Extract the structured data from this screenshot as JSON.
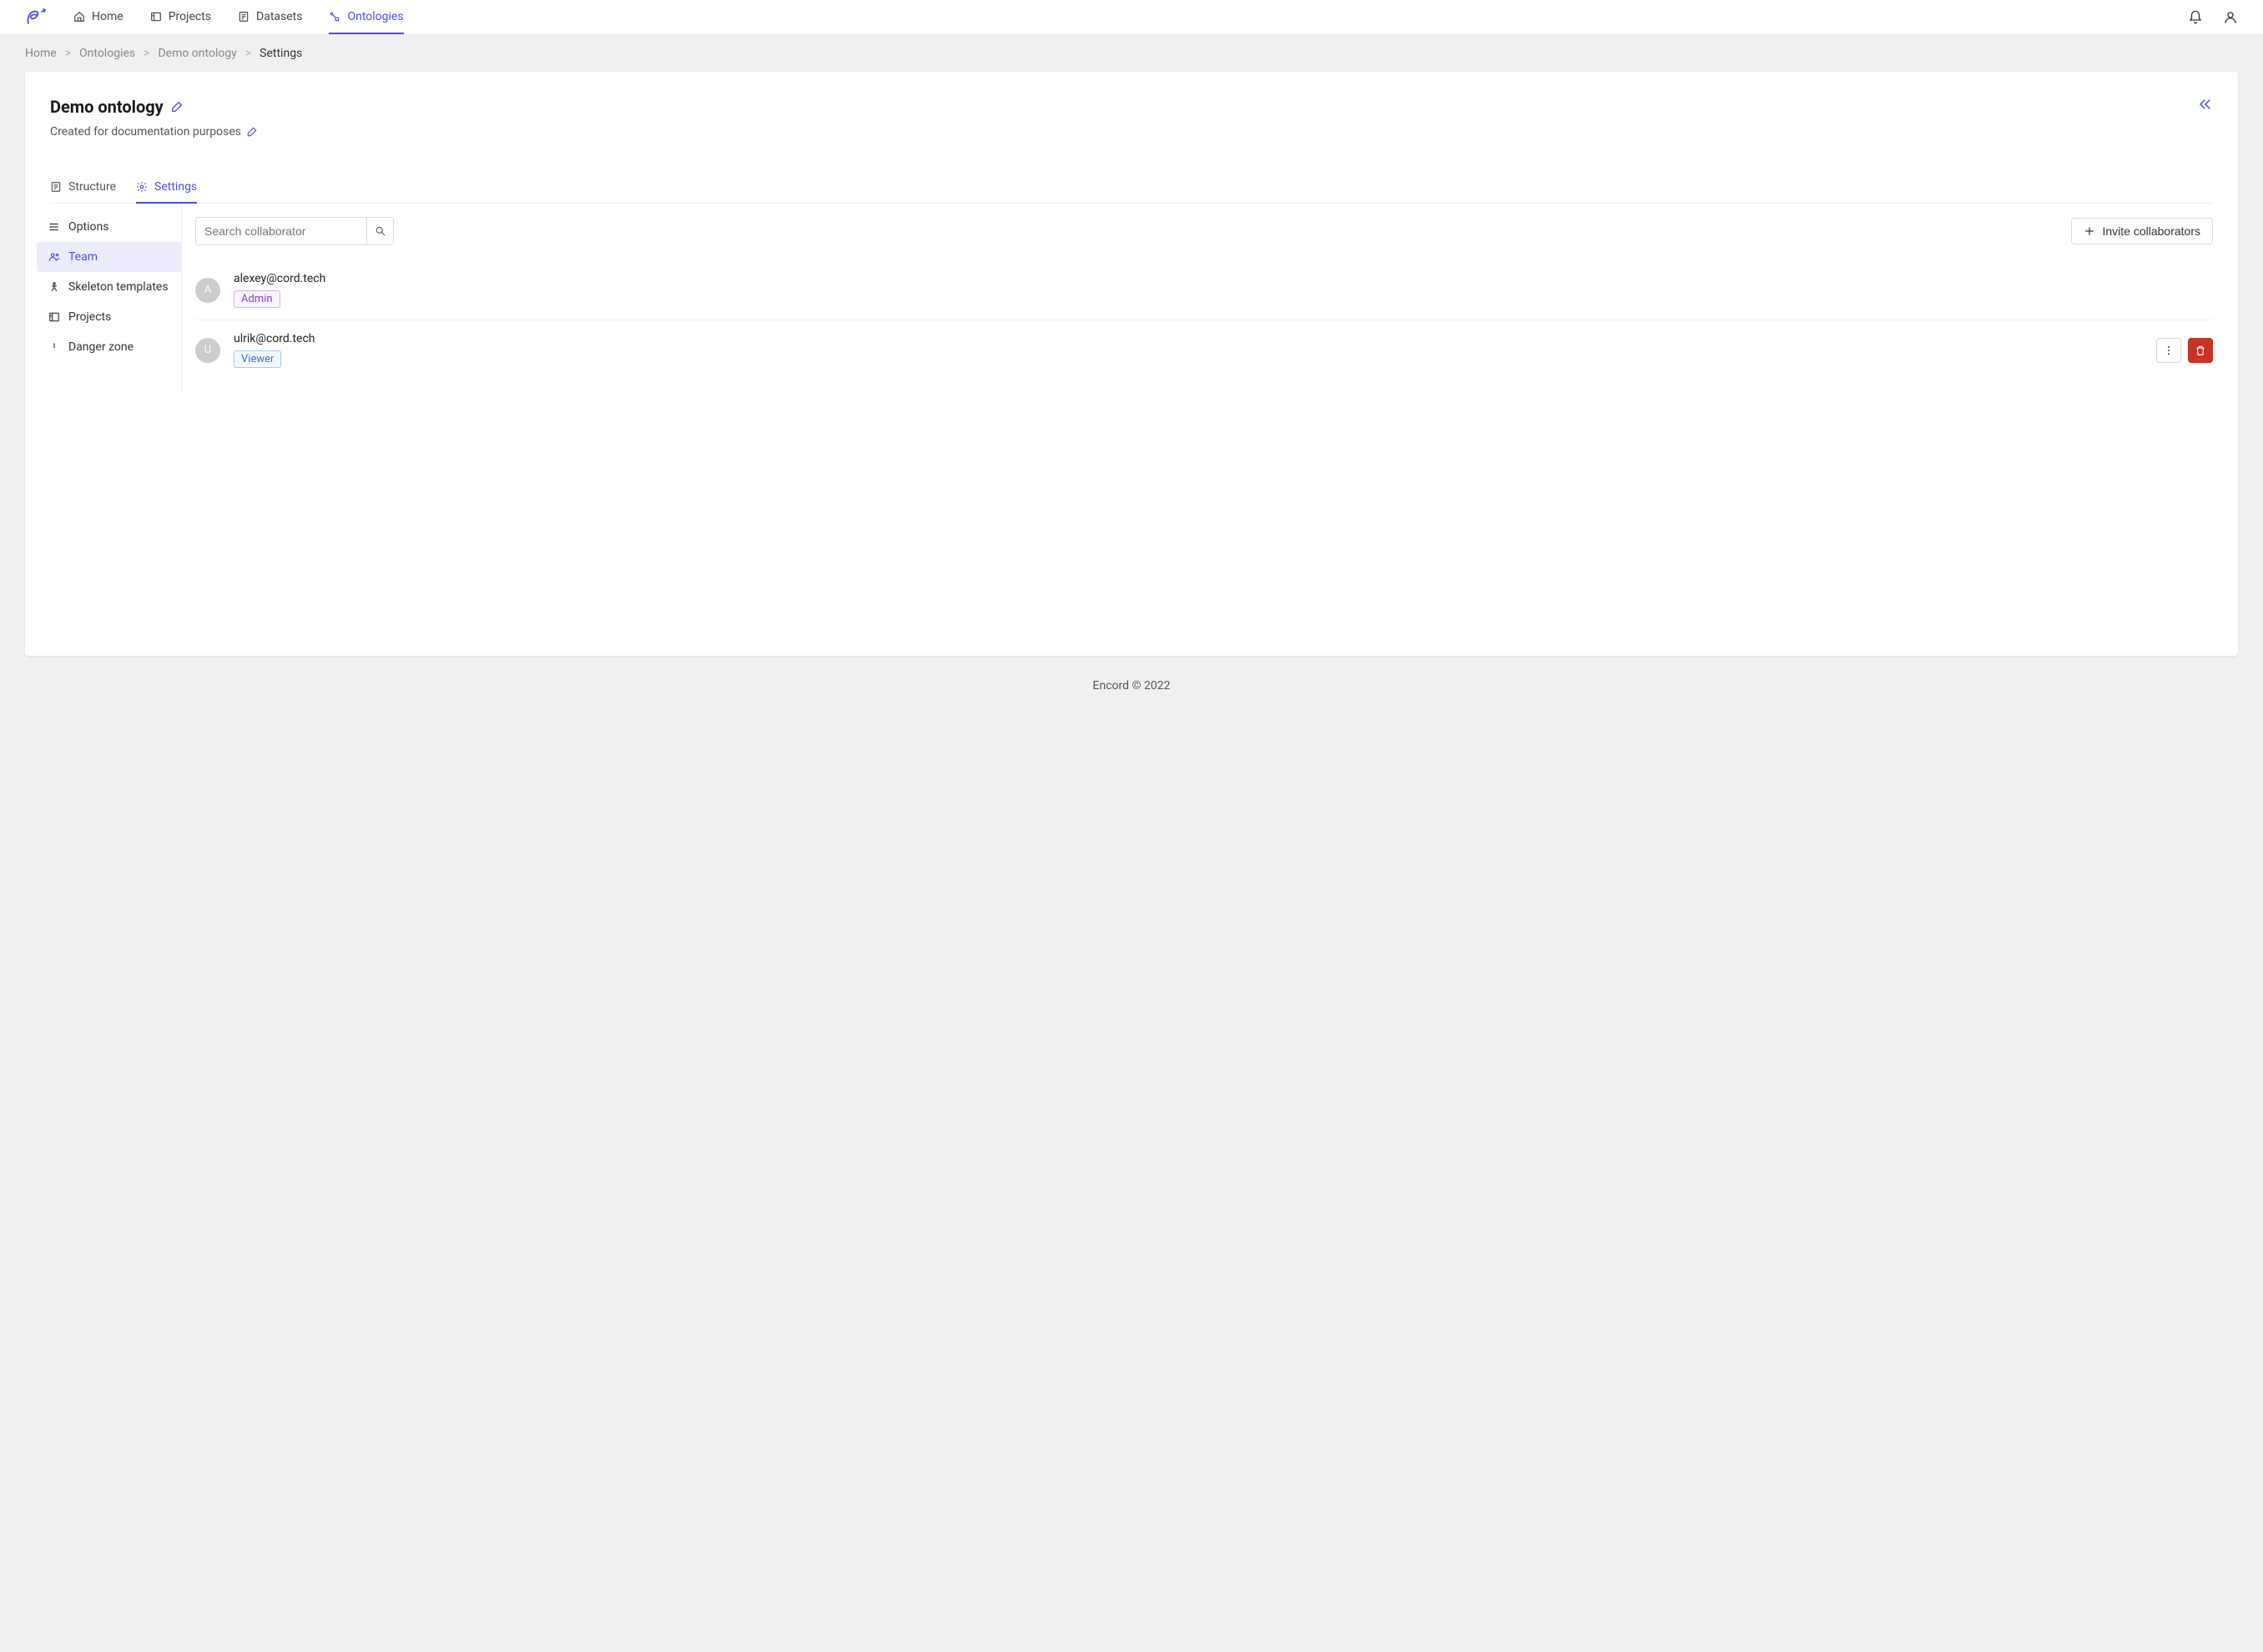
{
  "nav": {
    "items": [
      {
        "label": "Home"
      },
      {
        "label": "Projects"
      },
      {
        "label": "Datasets"
      },
      {
        "label": "Ontologies"
      }
    ]
  },
  "breadcrumb": {
    "items": [
      "Home",
      "Ontologies",
      "Demo ontology"
    ],
    "current": "Settings"
  },
  "page": {
    "title": "Demo ontology",
    "description": "Created for documentation purposes"
  },
  "tabs": {
    "structure": "Structure",
    "settings": "Settings"
  },
  "sidebar": {
    "items": [
      {
        "label": "Options"
      },
      {
        "label": "Team"
      },
      {
        "label": "Skeleton templates"
      },
      {
        "label": "Projects"
      },
      {
        "label": "Danger zone"
      }
    ]
  },
  "search": {
    "placeholder": "Search collaborator"
  },
  "invite_label": "Invite collaborators",
  "collaborators": [
    {
      "initial": "A",
      "email": "alexey@cord.tech",
      "role": "Admin",
      "role_class": "admin",
      "show_actions": false
    },
    {
      "initial": "U",
      "email": "ulrik@cord.tech",
      "role": "Viewer",
      "role_class": "viewer",
      "show_actions": true
    }
  ],
  "footer": "Encord © 2022"
}
